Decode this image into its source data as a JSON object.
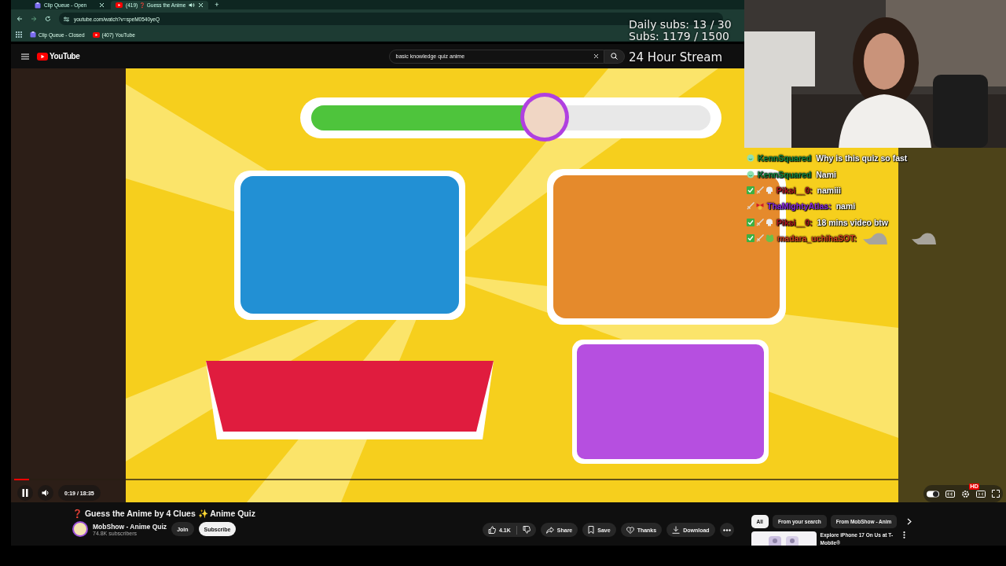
{
  "browser": {
    "tabs": [
      {
        "title": "Clip Queue - Open",
        "kind": "queue",
        "selected": false,
        "audio": false
      },
      {
        "title": "(419) ❓ Guess the Anime",
        "kind": "youtube",
        "selected": true,
        "audio": true
      }
    ],
    "new_tab": "+",
    "url": "youtube.com/watch?v=speM0540yeQ",
    "bookmarks": [
      {
        "label": "Clip Queue - Closed",
        "kind": "queue"
      },
      {
        "label": "(407) YouTube",
        "kind": "youtube"
      }
    ]
  },
  "youtube": {
    "logo": "YouTube",
    "search": {
      "value": "basic knowledge quiz anime"
    }
  },
  "player": {
    "video": {
      "kind": "picture"
    },
    "progress": {
      "level": 0.017
    },
    "paused": false,
    "muted": false,
    "time": "0:19 / 18:35",
    "autoplay": true,
    "quality_badge": "HD"
  },
  "video": {
    "title": "❓ Guess the Anime by 4 Clues ✨ Anime Quiz",
    "channel": {
      "name": "MobShow - Anime Quiz",
      "subscribers": "74.8K subscribers"
    },
    "join": "Join",
    "subscribe": "Subscribe",
    "subscribed": false,
    "actions": [
      {
        "kind": "like",
        "label": "4.1K"
      },
      {
        "kind": "dislike"
      },
      {
        "kind": "share",
        "label": "Share"
      },
      {
        "kind": "save",
        "label": "Save"
      },
      {
        "kind": "thanks",
        "label": "Thanks"
      },
      {
        "kind": "download",
        "label": "Download"
      },
      {
        "kind": "more"
      }
    ]
  },
  "related": {
    "chips": [
      {
        "label": "All",
        "selected": true
      },
      {
        "label": "From your search",
        "selected": false
      },
      {
        "label": "From MobShow - Anim",
        "selected": false
      }
    ],
    "items": [
      {
        "kind": "picture",
        "title": "Explore iPhone 17 On Us at T-Mobile®"
      }
    ]
  },
  "overlay": {
    "goals": [
      "Daily subs: 13 / 30",
      "Subs: 1179 / 1500"
    ],
    "event": "24 Hour Stream",
    "webcam": {
      "kind": "picture"
    }
  },
  "chat": [
    {
      "user": "KennSquared",
      "color": "#128a42",
      "badges": [
        {
          "kind": "smile"
        }
      ],
      "message": "Why is this quiz so fast"
    },
    {
      "user": "KennSquared",
      "color": "#128a42",
      "badges": [
        {
          "kind": "smile"
        }
      ],
      "message": "Nami"
    },
    {
      "user": "Piksi__0:",
      "color": "#b0151e",
      "badges": [
        {
          "kind": "check"
        },
        {
          "kind": "sword"
        },
        {
          "kind": "skull"
        }
      ],
      "message": "namiii"
    },
    {
      "user": "ThaMightyAtlas:",
      "color": "#8a2be2",
      "badges": [
        {
          "kind": "sword"
        },
        {
          "kind": "bow"
        }
      ],
      "message": "nami"
    },
    {
      "user": "Piksi__0:",
      "color": "#b0151e",
      "badges": [
        {
          "kind": "check"
        },
        {
          "kind": "sword"
        },
        {
          "kind": "skull"
        }
      ],
      "message": "18 mins video btw"
    },
    {
      "user": "madara_uchihaSOT:",
      "color": "#d2421e",
      "badges": [
        {
          "kind": "check"
        },
        {
          "kind": "sword"
        },
        {
          "kind": "frog"
        }
      ],
      "emotes": [
        {
          "kind": "bird"
        },
        {
          "kind": "bird"
        }
      ]
    }
  ]
}
